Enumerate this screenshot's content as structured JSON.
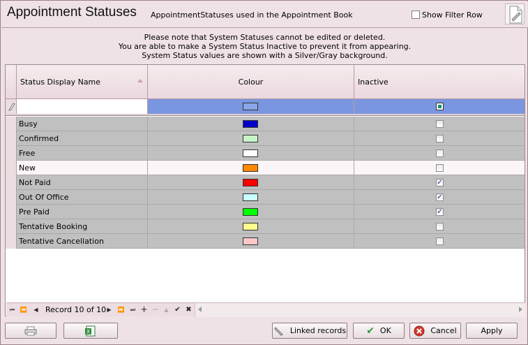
{
  "header": {
    "title": "Appointment Statuses",
    "subtitle": "AppointmentStatuses used in the Appointment Book",
    "show_filter_label": "Show Filter Row",
    "show_filter_checked": false
  },
  "notice": {
    "line1": "Please note that System Statuses cannot be edited or deleted.",
    "line2": "You are able to make a System Status Inactive to prevent it from appearing.",
    "line3": "System Status values are shown with a Silver/Gray background."
  },
  "grid": {
    "columns": [
      "Status Display Name",
      "Colour",
      "Inactive"
    ],
    "sort_column": "Status Display Name",
    "filter_row": {
      "name": "",
      "colour": "#8aa6e8",
      "inactive_state": "indeterminate"
    },
    "rows": [
      {
        "name": "Busy",
        "colour": "#0000c8",
        "inactive": false,
        "system": true
      },
      {
        "name": "Confirmed",
        "colour": "#c8f5c8",
        "inactive": false,
        "system": true
      },
      {
        "name": "Free",
        "colour": "#ffffff",
        "inactive": false,
        "system": true
      },
      {
        "name": "New",
        "colour": "#ff8a00",
        "inactive": false,
        "system": false
      },
      {
        "name": "Not Paid",
        "colour": "#ff0000",
        "inactive": true,
        "system": true
      },
      {
        "name": "Out Of Office",
        "colour": "#c8ffff",
        "inactive": true,
        "system": true
      },
      {
        "name": "Pre Paid",
        "colour": "#00ff00",
        "inactive": true,
        "system": true
      },
      {
        "name": "Tentative Booking",
        "colour": "#ffff8c",
        "inactive": false,
        "system": true
      },
      {
        "name": "Tentative Cancellation",
        "colour": "#ffc8c8",
        "inactive": false,
        "system": true
      }
    ]
  },
  "navigator": {
    "record_text": "Record 10 of 10"
  },
  "buttons": {
    "print_label": "",
    "export_label": "",
    "linked_records": "Linked records",
    "ok": "OK",
    "cancel": "Cancel",
    "apply": "Apply"
  },
  "colors": {
    "system_row_bg": "#c0c0c0",
    "user_row_bg": "#fbf5f7",
    "accent": "#efe2e6",
    "filter_row_highlight": "#7b96e0"
  }
}
